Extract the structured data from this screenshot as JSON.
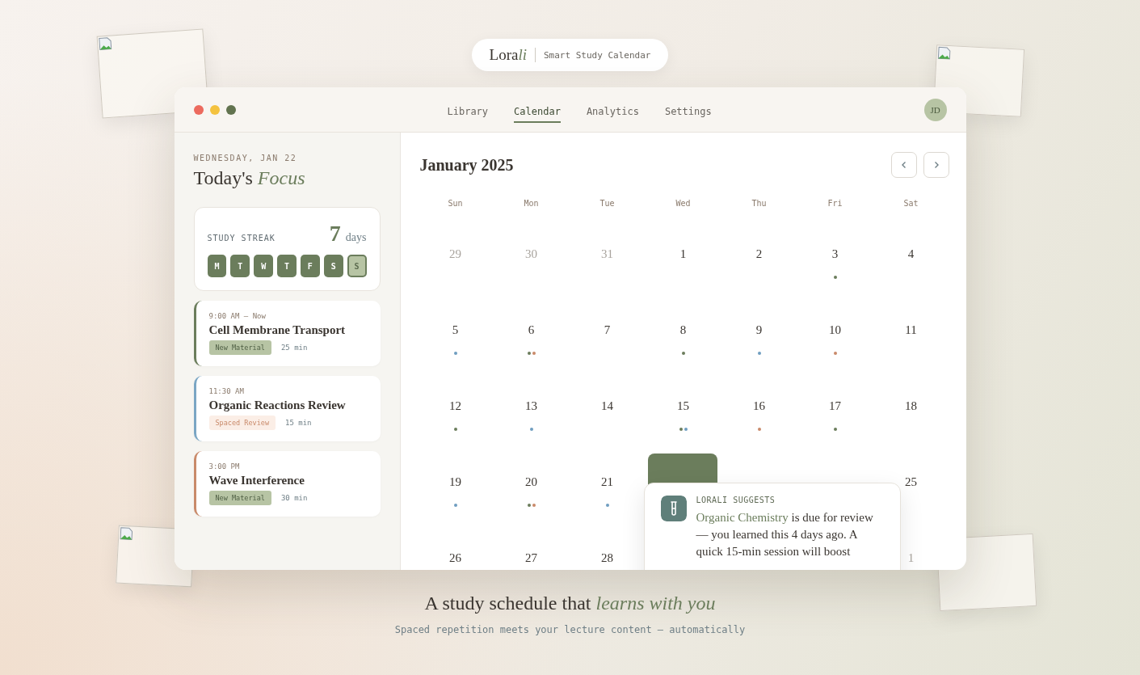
{
  "decor_cards": [
    {
      "kind": "broken-image"
    },
    {
      "kind": "broken-image"
    },
    {
      "kind": "broken-image"
    },
    {
      "kind": "plain"
    }
  ],
  "brand": {
    "name": "Lora",
    "name_accent": "li",
    "tagline": "Smart Study Calendar"
  },
  "window": {
    "traffic_lights": [
      {
        "color": "#ec6a5e"
      },
      {
        "color": "#f4c23f"
      },
      {
        "color": "#62734f"
      }
    ],
    "nav": [
      {
        "label": "Library",
        "selected": false
      },
      {
        "label": "Calendar",
        "selected": true
      },
      {
        "label": "Analytics",
        "selected": false
      },
      {
        "label": "Settings",
        "selected": false
      }
    ],
    "avatar": "JD"
  },
  "sidebar": {
    "date": "WEDNESDAY, JAN 22",
    "heading": "Today's *Focus*",
    "streak": {
      "label": "STUDY STREAK",
      "count": "7",
      "unit": "days",
      "days": [
        {
          "label": "M",
          "today": false
        },
        {
          "label": "T",
          "today": false
        },
        {
          "label": "W",
          "today": false
        },
        {
          "label": "T",
          "today": false
        },
        {
          "label": "F",
          "today": false
        },
        {
          "label": "S",
          "today": false
        },
        {
          "label": "S",
          "today": true
        }
      ]
    },
    "sessions": [
      {
        "time": "9:00 AM — Now",
        "title": "Cell Membrane Transport",
        "tag": {
          "label": "New Material",
          "kind": "new"
        },
        "duration": "25 min",
        "color": "#6b7d5c"
      },
      {
        "time": "11:30 AM",
        "title": "Organic Reactions Review",
        "tag": {
          "label": "Spaced Review",
          "kind": "review"
        },
        "duration": "15 min",
        "color": "#7aa6c4"
      },
      {
        "time": "3:00 PM",
        "title": "Wave Interference",
        "tag": {
          "label": "New Material",
          "kind": "new"
        },
        "duration": "30 min",
        "color": "#c98a6a"
      }
    ]
  },
  "calendar": {
    "title": "January 2025",
    "weekdays": [
      "Sun",
      "Mon",
      "Tue",
      "Wed",
      "Thu",
      "Fri",
      "Sat"
    ],
    "days": [
      {
        "kind": "day",
        "label": "29",
        "muted": true
      },
      {
        "kind": "day",
        "label": "30",
        "muted": true
      },
      {
        "kind": "day",
        "label": "31",
        "muted": true
      },
      {
        "kind": "day",
        "label": "1",
        "muted": false
      },
      {
        "kind": "day",
        "label": "2",
        "muted": false
      },
      {
        "kind": "day",
        "label": "3",
        "muted": false,
        "dots": [
          {
            "color": "#6b7d5c"
          }
        ]
      },
      {
        "kind": "day",
        "label": "4",
        "muted": false
      },
      {
        "kind": "day",
        "label": "5",
        "muted": false,
        "dots": [
          {
            "color": "#6f9ec0"
          }
        ]
      },
      {
        "kind": "day",
        "label": "6",
        "muted": false,
        "dots": [
          {
            "color": "#6b7d5c"
          },
          {
            "color": "#c98a6a"
          }
        ]
      },
      {
        "kind": "day",
        "label": "7",
        "muted": false
      },
      {
        "kind": "day",
        "label": "8",
        "muted": false,
        "dots": [
          {
            "color": "#6b7d5c"
          }
        ]
      },
      {
        "kind": "day",
        "label": "9",
        "muted": false,
        "dots": [
          {
            "color": "#6f9ec0"
          }
        ]
      },
      {
        "kind": "day",
        "label": "10",
        "muted": false,
        "dots": [
          {
            "color": "#c98a6a"
          }
        ]
      },
      {
        "kind": "day",
        "label": "11",
        "muted": false
      },
      {
        "kind": "day",
        "label": "12",
        "muted": false,
        "dots": [
          {
            "color": "#6b7d5c"
          }
        ]
      },
      {
        "kind": "day",
        "label": "13",
        "muted": false,
        "dots": [
          {
            "color": "#6f9ec0"
          }
        ]
      },
      {
        "kind": "day",
        "label": "14",
        "muted": false
      },
      {
        "kind": "day",
        "label": "15",
        "muted": false,
        "dots": [
          {
            "color": "#6b7d5c"
          },
          {
            "color": "#6f9ec0"
          }
        ]
      },
      {
        "kind": "day",
        "label": "16",
        "muted": false,
        "dots": [
          {
            "color": "#c98a6a"
          }
        ]
      },
      {
        "kind": "day",
        "label": "17",
        "muted": false,
        "dots": [
          {
            "color": "#6b7d5c"
          }
        ]
      },
      {
        "kind": "day",
        "label": "18",
        "muted": false
      },
      {
        "kind": "day",
        "label": "19",
        "muted": false,
        "dots": [
          {
            "color": "#6f9ec0"
          }
        ]
      },
      {
        "kind": "day",
        "label": "20",
        "muted": false,
        "dots": [
          {
            "color": "#6b7d5c"
          },
          {
            "color": "#c98a6a"
          }
        ]
      },
      {
        "kind": "day",
        "label": "21",
        "muted": false,
        "dots": [
          {
            "color": "#6f9ec0"
          }
        ]
      },
      {
        "kind": "selected"
      },
      {
        "kind": "covered"
      },
      {
        "kind": "covered"
      },
      {
        "kind": "day",
        "label": "25",
        "muted": false
      },
      {
        "kind": "day",
        "label": "26",
        "muted": false
      },
      {
        "kind": "day",
        "label": "27",
        "muted": false
      },
      {
        "kind": "day",
        "label": "28",
        "muted": false
      },
      {
        "kind": "covered"
      },
      {
        "kind": "covered"
      },
      {
        "kind": "covered"
      },
      {
        "kind": "day",
        "label": "1",
        "muted": true
      }
    ],
    "suggestion": {
      "title": "LORALI SUGGESTS",
      "text": "**Organic Chemistry** is due for review — you learned this 4 days ago. A quick 15-min session will boost"
    }
  },
  "footer": {
    "heading": "A study schedule that *learns with you*",
    "subtitle": "Spaced repetition meets your lecture content — automatically"
  }
}
